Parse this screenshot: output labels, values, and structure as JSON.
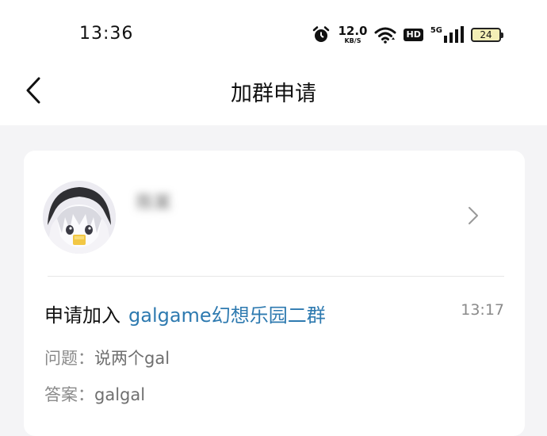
{
  "status_bar": {
    "time": "13:36",
    "net_speed_value": "12.0",
    "net_speed_unit": "KB/S",
    "hd_label": "HD",
    "network_label": "5G",
    "battery_level": "24",
    "icons": [
      "alarm-icon",
      "wifi-icon",
      "signal-icon",
      "battery-icon"
    ]
  },
  "nav": {
    "back_icon": "chevron-left-icon",
    "title": "加群申请"
  },
  "request": {
    "username": "陈某",
    "avatar_icon": "anime-avatar",
    "apply_prefix": "申请加入",
    "group_name": "galgame幻想乐园二群",
    "time": "13:17",
    "question_label": "问题：",
    "question_value": "说两个gal",
    "answer_label": "答案：",
    "answer_value": "galgal",
    "link_color": "#2e7ab0"
  }
}
